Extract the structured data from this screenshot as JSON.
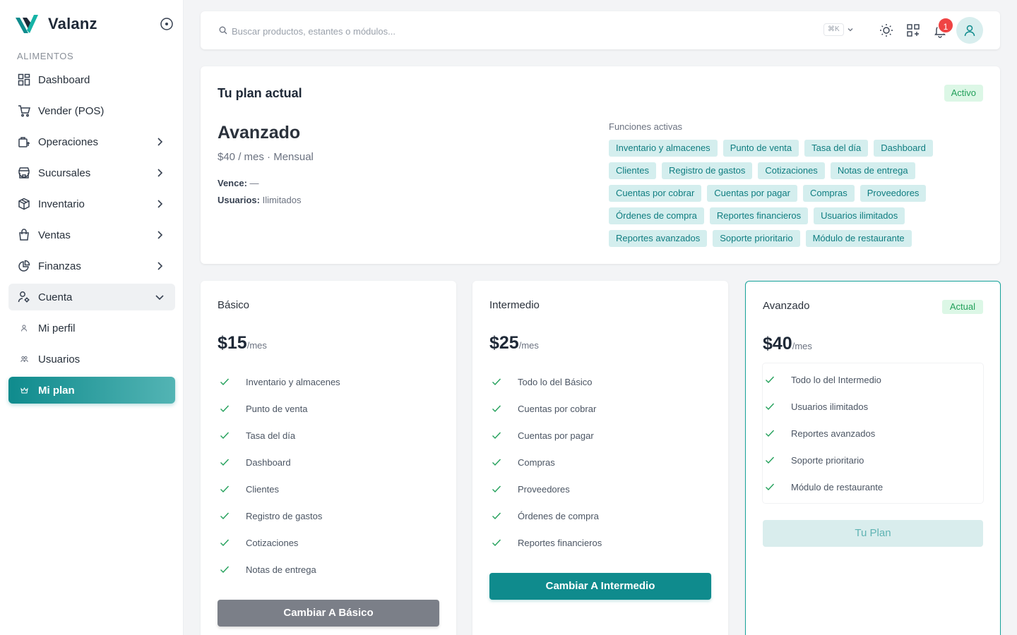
{
  "brand": {
    "name": "Valanz"
  },
  "sidebar": {
    "section": "ALIMENTOS",
    "items": [
      {
        "label": "Dashboard",
        "icon": "dashboard-grid-icon",
        "chevron": false
      },
      {
        "label": "Vender (POS)",
        "icon": "cart-icon",
        "chevron": false
      },
      {
        "label": "Operaciones",
        "icon": "operations-icon",
        "chevron": true
      },
      {
        "label": "Sucursales",
        "icon": "store-icon",
        "chevron": true
      },
      {
        "label": "Inventario",
        "icon": "box-icon",
        "chevron": true
      },
      {
        "label": "Ventas",
        "icon": "shopping-bag-icon",
        "chevron": true
      },
      {
        "label": "Finanzas",
        "icon": "pie-chart-icon",
        "chevron": true
      },
      {
        "label": "Cuenta",
        "icon": "user-settings-icon",
        "chevron": "open"
      }
    ],
    "subitems": [
      {
        "label": "Mi perfil",
        "icon": "user-icon"
      },
      {
        "label": "Usuarios",
        "icon": "users-icon"
      },
      {
        "label": "Mi plan",
        "icon": "crown-icon"
      }
    ]
  },
  "topbar": {
    "search_placeholder": "Buscar productos, estantes o módulos...",
    "shortcut": "⌘K",
    "notifications_count": "1"
  },
  "current_plan": {
    "title": "Tu plan actual",
    "status": "Activo",
    "name": "Avanzado",
    "price": "$40 / mes · Mensual",
    "expires_label": "Vence:",
    "expires_value": "—",
    "users_label": "Usuarios:",
    "users_value": "Ilimitados",
    "features_label": "Funciones activas",
    "features": [
      "Inventario y almacenes",
      "Punto de venta",
      "Tasa del día",
      "Dashboard",
      "Clientes",
      "Registro de gastos",
      "Cotizaciones",
      "Notas de entrega",
      "Cuentas por cobrar",
      "Cuentas por pagar",
      "Compras",
      "Proveedores",
      "Órdenes de compra",
      "Reportes financieros",
      "Usuarios ilimitados",
      "Reportes avanzados",
      "Soporte prioritario",
      "Módulo de restaurante"
    ]
  },
  "tiers": [
    {
      "name": "Básico",
      "amount": "$15",
      "per": "/mes",
      "features": [
        "Inventario y almacenes",
        "Punto de venta",
        "Tasa del día",
        "Dashboard",
        "Clientes",
        "Registro de gastos",
        "Cotizaciones",
        "Notas de entrega"
      ],
      "button": "Cambiar A Básico"
    },
    {
      "name": "Intermedio",
      "amount": "$25",
      "per": "/mes",
      "features": [
        "Todo lo del Básico",
        "Cuentas por cobrar",
        "Cuentas por pagar",
        "Compras",
        "Proveedores",
        "Órdenes de compra",
        "Reportes financieros"
      ],
      "button": "Cambiar A Intermedio"
    },
    {
      "name": "Avanzado",
      "amount": "$40",
      "per": "/mes",
      "tag": "Actual",
      "features": [
        "Todo lo del Intermedio",
        "Usuarios ilimitados",
        "Reportes avanzados",
        "Soporte prioritario",
        "Módulo de restaurante"
      ],
      "button": "Tu Plan"
    }
  ],
  "colors": {
    "accent": "#0f8b8d",
    "chip_bg": "#d4eeee",
    "success": "#22a05a",
    "danger": "#ef4444"
  }
}
